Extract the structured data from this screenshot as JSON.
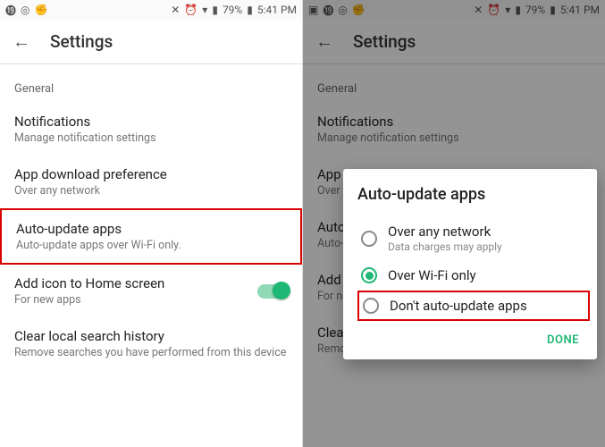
{
  "status": {
    "left_icons": [
      "79",
      "◎",
      "✋"
    ],
    "left_icons2": [
      "🖼",
      "79",
      "◎",
      "✋"
    ],
    "right_text": "79%",
    "time": "5:41 PM"
  },
  "app_bar": {
    "title": "Settings"
  },
  "section": "General",
  "rows": {
    "notifications": {
      "title": "Notifications",
      "sub": "Manage notification settings"
    },
    "download": {
      "title": "App download preference",
      "sub": "Over any network"
    },
    "autoupdate": {
      "title": "Auto-update apps",
      "sub": "Auto-update apps over Wi-Fi only."
    },
    "addicon": {
      "title": "Add icon to Home screen",
      "sub": "For new apps"
    },
    "clear": {
      "title": "Clear local search history",
      "sub": "Remove searches you have performed from this device"
    }
  },
  "rows_trunc": {
    "download": {
      "title": "App do",
      "sub": "Over ar"
    },
    "autoupdate": {
      "title": "Auto-u",
      "sub": "Auto-u"
    },
    "addicon": {
      "title": "Add i",
      "sub": "For ne"
    },
    "clear": {
      "title": "Clear"
    }
  },
  "dialog": {
    "title": "Auto-update apps",
    "opt1": {
      "label": "Over any network",
      "sub": "Data charges may apply"
    },
    "opt2": {
      "label": "Over Wi-Fi only"
    },
    "opt3": {
      "label": "Don't auto-update apps"
    },
    "done": "DONE"
  }
}
